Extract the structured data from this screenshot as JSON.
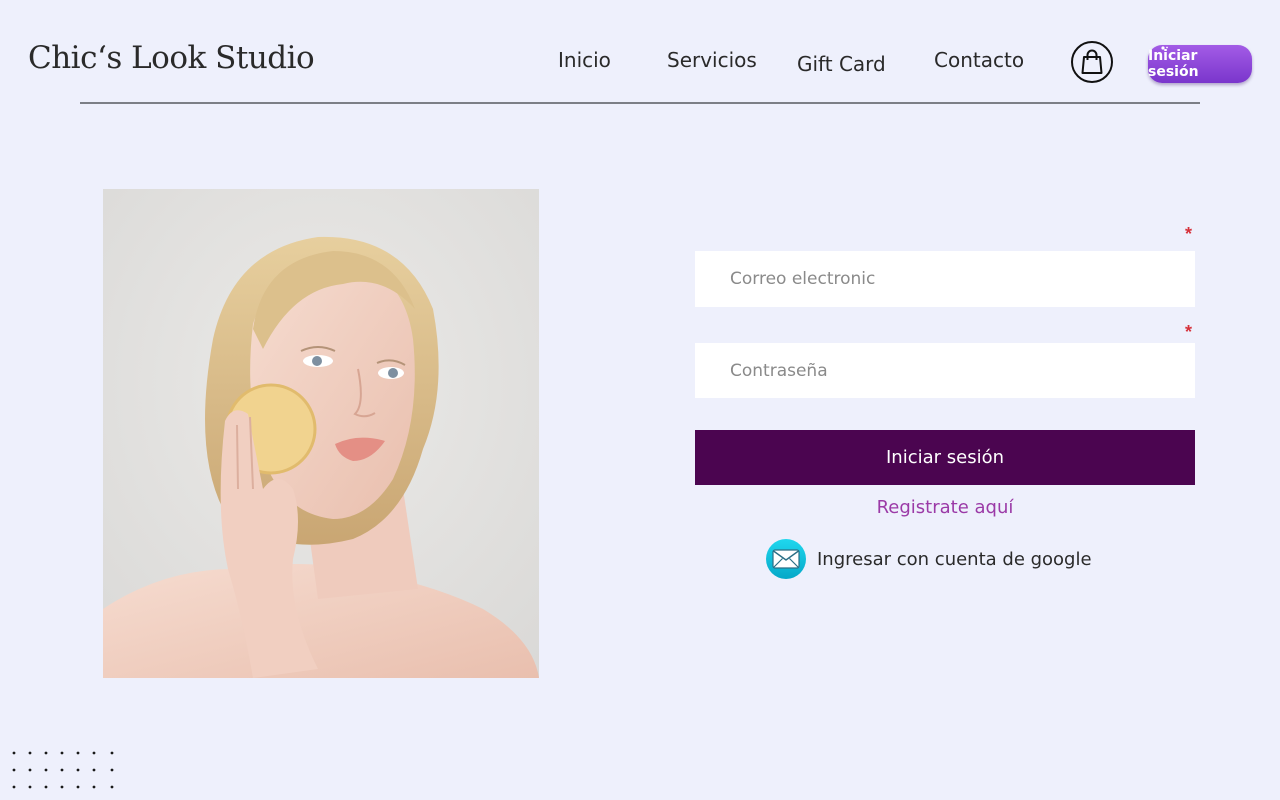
{
  "brand": {
    "name": "Chic‘s Look Studio"
  },
  "nav": {
    "items": [
      {
        "label": "Inicio"
      },
      {
        "label": "Servicios"
      },
      {
        "label": "Gift Card"
      },
      {
        "label": "Contacto"
      }
    ],
    "cart_icon": "shopping-bag-icon",
    "login_label": "Iniciar sesión"
  },
  "hero": {
    "image": "woman-with-sponge-photo"
  },
  "form": {
    "required_marker": "*",
    "email": {
      "placeholder": "Correo electronic",
      "value": ""
    },
    "password": {
      "placeholder": "Contraseña",
      "value": ""
    },
    "submit_label": "Iniciar sesión",
    "register_label": "Registrate aquí",
    "google_label": "Ingresar con cuenta de google",
    "google_icon": "mail-envelope-icon"
  },
  "colors": {
    "background": "#eef0fc",
    "submit_bg": "#4b0550",
    "link": "#9b3aa7",
    "pill_start": "#a35ce6",
    "pill_end": "#7a36cc",
    "required": "#d6313a"
  }
}
